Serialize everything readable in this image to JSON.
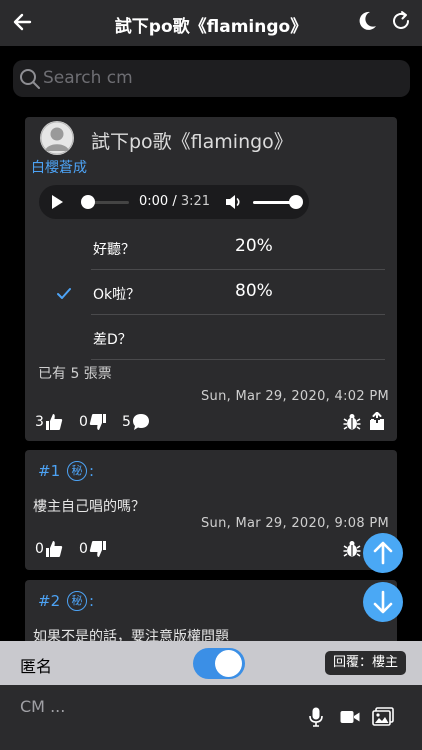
{
  "header": {
    "title": "試下po歌《flamingo》"
  },
  "search": {
    "placeholder": "Search cm"
  },
  "post": {
    "title": "試下po歌《flamingo》",
    "author": "白櫻蒼成",
    "audio": {
      "current": "0:00",
      "duration": "3:21",
      "progress": 0,
      "volume": 1.0
    },
    "poll": [
      {
        "option": "好聽？",
        "percent": "20%",
        "selected": false
      },
      {
        "option": "Ok啦？",
        "percent": "80%",
        "selected": true
      },
      {
        "option": "差D？",
        "percent": "",
        "selected": false
      }
    ],
    "votes_text": "已有 5 張票",
    "timestamp": "Sun, Mar 29, 2020, 4:02 PM",
    "likes": "3",
    "dislikes": "0",
    "comments": "5"
  },
  "comments": [
    {
      "number": "#1",
      "secret_badge": "秘",
      "colon": ":",
      "text": "樓主自己唱的嗎？",
      "timestamp": "Sun, Mar 29, 2020, 9:08 PM",
      "likes": "0",
      "dislikes": "0"
    },
    {
      "number": "#2",
      "secret_badge": "秘",
      "colon": ":",
      "text": "如果不是的話，要注意版權問題"
    }
  ],
  "anon_bar": {
    "label": "匿名",
    "anonymous_on": true,
    "reply_to": "回覆：樓主"
  },
  "composer": {
    "placeholder": "CM ..."
  },
  "colors": {
    "accent": "#4da3f5",
    "fab": "#4aa8f5",
    "background": "#000000",
    "card": "#2b2b2d"
  }
}
